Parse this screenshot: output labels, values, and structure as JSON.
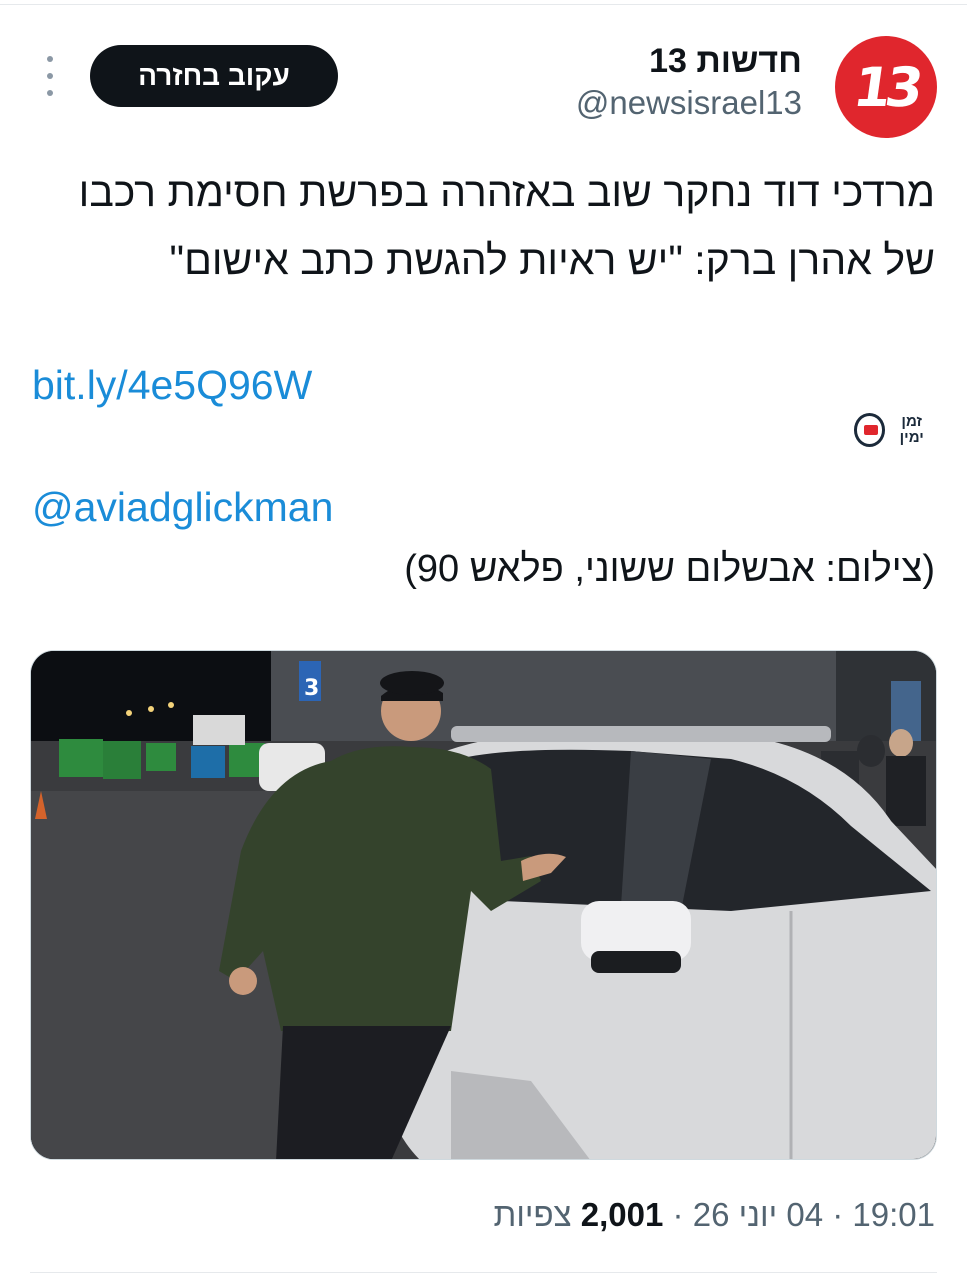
{
  "header": {
    "display_name": "חדשות 13",
    "handle": "@newsisrael13",
    "avatar_text": "13",
    "follow_label": "עקוב בחזרה",
    "more_icon": "more-vertical-icon",
    "avatar_color": "#e0262d"
  },
  "tweet": {
    "text": "מרדכי דוד נחקר שוב באזהרה בפרשת חסימת רכבו של אהרן ברק: \"יש ראיות להגשת כתב אישום\"",
    "link": "bit.ly/4e5Q96W",
    "brand_badge": "זמן ימין",
    "mention": "@aviadglickman",
    "credit": "(צילום: אבשלום ששוני, פלאש 90)"
  },
  "media": {
    "sign_number": "3"
  },
  "meta": {
    "time": "19:01",
    "date": "04 יוני 26",
    "views": "2,001",
    "views_label": "צפיות",
    "separator": "·"
  },
  "colors": {
    "link": "#1a8cd8",
    "button_bg": "#0f1419",
    "secondary_text": "#536471"
  }
}
